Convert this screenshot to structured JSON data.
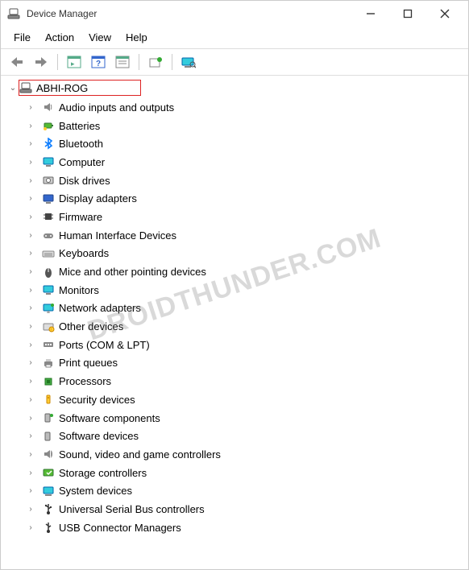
{
  "window": {
    "title": "Device Manager"
  },
  "menu": {
    "items": [
      "File",
      "Action",
      "View",
      "Help"
    ]
  },
  "toolbar": {
    "icons": [
      "back",
      "forward",
      "show-hidden",
      "help",
      "properties",
      "update",
      "scan"
    ]
  },
  "root": {
    "label": "ABHI-ROG",
    "expanded": true
  },
  "categories": [
    {
      "icon": "audio",
      "label": "Audio inputs and outputs"
    },
    {
      "icon": "battery",
      "label": "Batteries"
    },
    {
      "icon": "bluetooth",
      "label": "Bluetooth"
    },
    {
      "icon": "monitor",
      "label": "Computer"
    },
    {
      "icon": "disk",
      "label": "Disk drives"
    },
    {
      "icon": "display",
      "label": "Display adapters"
    },
    {
      "icon": "chip",
      "label": "Firmware"
    },
    {
      "icon": "hid",
      "label": "Human Interface Devices"
    },
    {
      "icon": "keyboard",
      "label": "Keyboards"
    },
    {
      "icon": "mouse",
      "label": "Mice and other pointing devices"
    },
    {
      "icon": "monitor",
      "label": "Monitors"
    },
    {
      "icon": "network",
      "label": "Network adapters"
    },
    {
      "icon": "other",
      "label": "Other devices"
    },
    {
      "icon": "port",
      "label": "Ports (COM & LPT)"
    },
    {
      "icon": "printer",
      "label": "Print queues"
    },
    {
      "icon": "cpu",
      "label": "Processors"
    },
    {
      "icon": "security",
      "label": "Security devices"
    },
    {
      "icon": "swcomp",
      "label": "Software components"
    },
    {
      "icon": "swdev",
      "label": "Software devices"
    },
    {
      "icon": "sound",
      "label": "Sound, video and game controllers"
    },
    {
      "icon": "storage",
      "label": "Storage controllers"
    },
    {
      "icon": "system",
      "label": "System devices"
    },
    {
      "icon": "usb",
      "label": "Universal Serial Bus controllers"
    },
    {
      "icon": "usbconn",
      "label": "USB Connector Managers"
    }
  ],
  "watermark": "DROIDTHUNDER.COM",
  "colors": {
    "highlight_border": "#d22",
    "bluetooth": "#0a7cff"
  }
}
